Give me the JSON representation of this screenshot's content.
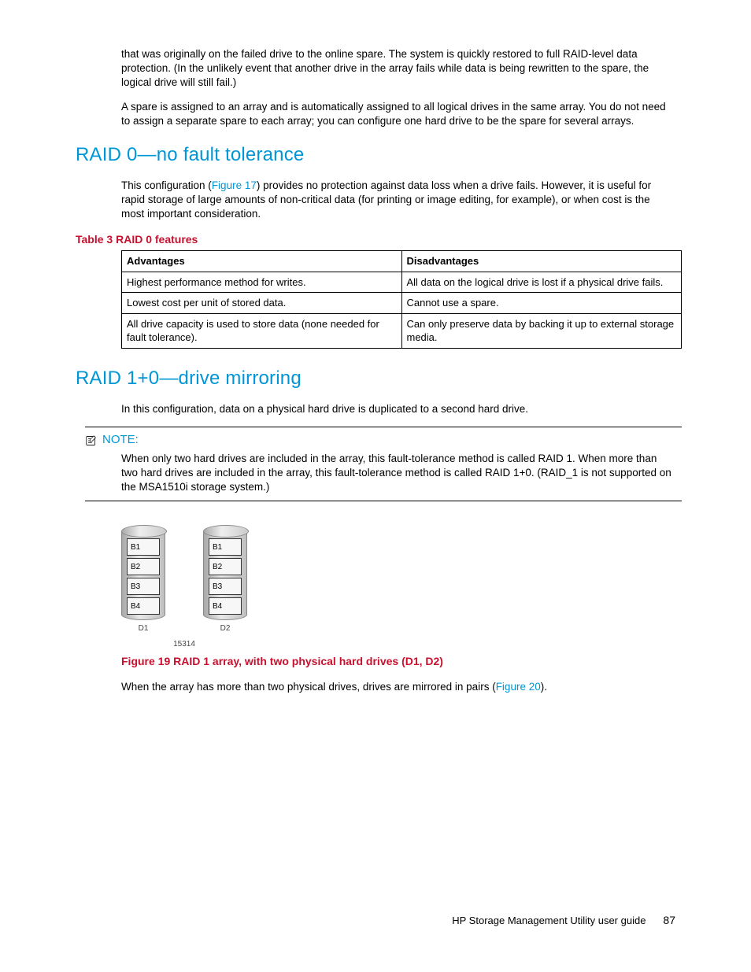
{
  "intro": {
    "p1": "that was originally on the failed drive to the online spare. The system is quickly restored to full RAID-level data protection. (In the unlikely event that another drive in the array fails while data is being rewritten to the spare, the logical drive will still fail.)",
    "p2": "A spare is assigned to an array and is automatically assigned to all logical drives in the same array. You do not need to assign a separate spare to each array; you can configure one hard drive to be the spare for several arrays."
  },
  "raid0": {
    "heading": "RAID 0—no fault tolerance",
    "desc_pre": "This configuration (",
    "desc_link": "Figure 17",
    "desc_post": ") provides no protection against data loss when a drive fails. However, it is useful for rapid storage of large amounts of non-critical data (for printing or image editing, for example), or when cost is the most important consideration.",
    "table_caption": "Table 3 RAID 0 features",
    "th_adv": "Advantages",
    "th_dis": "Disadvantages",
    "rows": [
      {
        "adv": "Highest performance method for writes.",
        "dis": "All data on the logical drive is lost if a physical drive fails."
      },
      {
        "adv": "Lowest cost per unit of stored data.",
        "dis": "Cannot use a spare."
      },
      {
        "adv": "All drive capacity is used to store data (none needed for fault tolerance).",
        "dis": "Can only preserve data by backing it up to external storage media."
      }
    ]
  },
  "raid10": {
    "heading": "RAID 1+0—drive mirroring",
    "desc": "In this configuration, data on a physical hard drive is duplicated to a second hard drive.",
    "note_label": "NOTE:",
    "note_body": "When only two hard drives are included in the array, this fault-tolerance method is called RAID 1. When more than two hard drives are included in the array, this fault-tolerance method is called RAID 1+0. (RAID_1 is not supported on the MSA1510i storage system.)",
    "figure": {
      "blocks": [
        "B1",
        "B2",
        "B3",
        "B4"
      ],
      "drive_labels": [
        "D1",
        "D2"
      ],
      "code": "15314",
      "caption": "Figure 19 RAID 1 array, with two physical hard drives (D1, D2)"
    },
    "after_pre": "When the array has more than two physical drives, drives are mirrored in pairs (",
    "after_link": "Figure 20",
    "after_post": ")."
  },
  "footer": {
    "title": "HP Storage Management Utility user guide",
    "page": "87"
  }
}
